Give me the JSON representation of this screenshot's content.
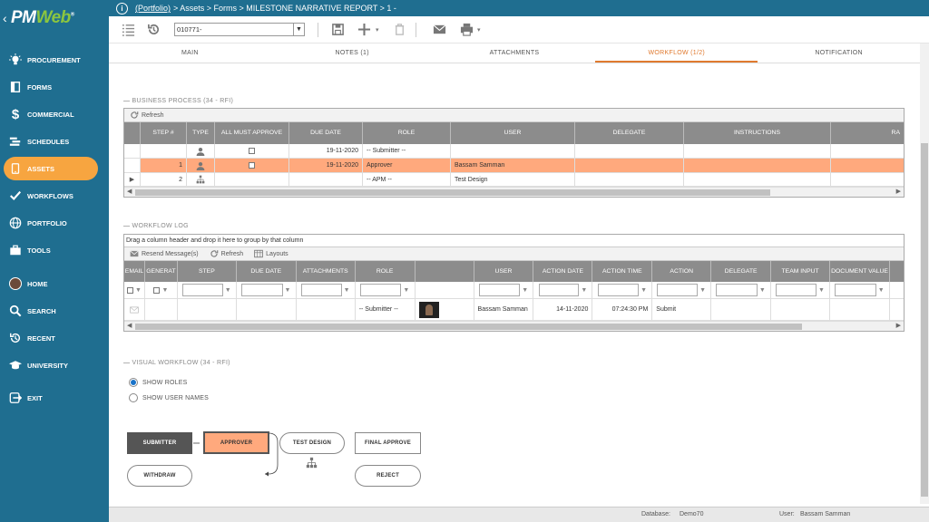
{
  "app": {
    "logo_pm": "PM",
    "logo_web": "Web",
    "logo_reg": "®"
  },
  "sidebar": {
    "items": [
      {
        "label": "PROCUREMENT",
        "icon": "bulb-icon"
      },
      {
        "label": "FORMS",
        "icon": "forms-icon"
      },
      {
        "label": "COMMERCIAL",
        "icon": "dollar-icon"
      },
      {
        "label": "SCHEDULES",
        "icon": "schedules-icon"
      },
      {
        "label": "ASSETS",
        "icon": "assets-icon",
        "active": true
      },
      {
        "label": "WORKFLOWS",
        "icon": "check-icon"
      },
      {
        "label": "PORTFOLIO",
        "icon": "globe-icon"
      },
      {
        "label": "TOOLS",
        "icon": "briefcase-icon"
      },
      {
        "label": "HOME",
        "icon": "avatar-icon"
      },
      {
        "label": "SEARCH",
        "icon": "search-icon"
      },
      {
        "label": "RECENT",
        "icon": "recent-icon"
      },
      {
        "label": "UNIVERSITY",
        "icon": "graduation-icon"
      },
      {
        "label": "EXIT",
        "icon": "exit-icon"
      }
    ]
  },
  "breadcrumb": {
    "link": "(Portfolio)",
    "rest": "> Assets > Forms > MILESTONE NARRATIVE REPORT > 1 -"
  },
  "toolbar": {
    "select_value": "010771-"
  },
  "tabs": [
    "MAIN",
    "NOTES (1)",
    "ATTACHMENTS",
    "WORKFLOW (1/2)",
    "NOTIFICATION"
  ],
  "business_process": {
    "title": "BUSINESS PROCESS (34 - RFI)",
    "refresh": "Refresh",
    "headers": [
      "STEP #",
      "TYPE",
      "ALL MUST APPROVE",
      "DUE DATE",
      "ROLE",
      "USER",
      "DELEGATE",
      "INSTRUCTIONS",
      "RA"
    ],
    "rows": [
      {
        "step": "",
        "due": "19-11-2020",
        "role": "-- Submitter --",
        "user": ""
      },
      {
        "step": "1",
        "due": "19-11-2020",
        "role": "Approver",
        "user": "Bassam Samman"
      },
      {
        "step": "2",
        "due": "",
        "role": "-- APM --",
        "user": "Test Design"
      }
    ]
  },
  "workflow_log": {
    "title": "WORKFLOW LOG",
    "group_hint": "Drag a column header and drop it here to group by that column",
    "resend": "Resend Message(s)",
    "refresh": "Refresh",
    "layouts": "Layouts",
    "headers": [
      "EMAIL",
      "GENERAT",
      "STEP",
      "DUE DATE",
      "ATTACHMENTS",
      "ROLE",
      "",
      "USER",
      "ACTION DATE",
      "ACTION TIME",
      "ACTION",
      "DELEGATE",
      "TEAM INPUT",
      "DOCUMENT VALUE"
    ],
    "row": {
      "role": "-- Submitter --",
      "user": "Bassam Samman",
      "action_date": "14-11-2020",
      "action_time": "07:24:30 PM",
      "action": "Submit"
    }
  },
  "visual_workflow": {
    "title": "VISUAL WORKFLOW (34 - RFI)",
    "show_roles": "SHOW ROLES",
    "show_user_names": "SHOW USER NAMES",
    "nodes": {
      "submitter": "SUBMITTER",
      "approver": "APPROVER",
      "test_design": "TEST DESIGN",
      "final_approve": "FINAL APPROVE",
      "withdraw": "WITHDRAW",
      "reject": "REJECT"
    }
  },
  "status": {
    "db_label": "Database:",
    "db_value": "Demo70",
    "user_label": "User:",
    "user_value": "Bassam Samman"
  }
}
